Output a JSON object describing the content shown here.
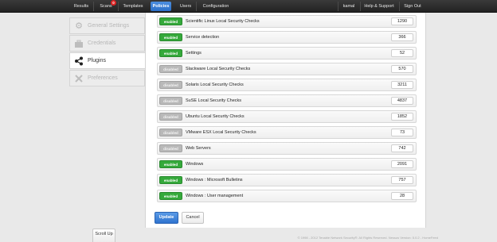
{
  "nav": {
    "results": "Results",
    "scans": "Scans",
    "scans_badge": "0",
    "templates": "Templates",
    "policies": "Policies",
    "users": "Users",
    "configuration": "Configuration",
    "user": "kamal",
    "help": "Help & Support",
    "signout": "Sign Out"
  },
  "sidebar": {
    "items": [
      {
        "label": "General Settings",
        "icon": "gear-icon"
      },
      {
        "label": "Credentials",
        "icon": "briefcase-icon"
      },
      {
        "label": "Plugins",
        "icon": "share-icon"
      },
      {
        "label": "Preferences",
        "icon": "wrench-screwdriver-icon"
      }
    ]
  },
  "plugin_rows": [
    {
      "status": "enabled",
      "name": "Scientific Linux Local Security Checks",
      "count": "1290"
    },
    {
      "status": "enabled",
      "name": "Service detection",
      "count": "366"
    },
    {
      "status": "enabled",
      "name": "Settings",
      "count": "52"
    },
    {
      "status": "disabled",
      "name": "Slackware Local Security Checks",
      "count": "570"
    },
    {
      "status": "disabled",
      "name": "Solaris Local Security Checks",
      "count": "3211"
    },
    {
      "status": "disabled",
      "name": "SuSE Local Security Checks",
      "count": "4837"
    },
    {
      "status": "disabled",
      "name": "Ubuntu Local Security Checks",
      "count": "1852"
    },
    {
      "status": "disabled",
      "name": "VMware ESX Local Security Checks",
      "count": "73"
    },
    {
      "status": "disabled",
      "name": "Web Servers",
      "count": "742"
    },
    {
      "status": "enabled",
      "name": "Windows",
      "count": "2091"
    },
    {
      "status": "enabled",
      "name": "Windows : Microsoft Bulletins",
      "count": "757"
    },
    {
      "status": "enabled",
      "name": "Windows : User management",
      "count": "28"
    }
  ],
  "buttons": {
    "update": "Update",
    "cancel": "Cancel"
  },
  "footer": "© 1998 - 2012 Tenable Network Security®. All Rights Reserved. Nessus Version: 5.0.2 - HomeFeed",
  "scroll_up": "Scroll Up",
  "colors": {
    "enabled": "#35a93b",
    "disabled": "#b9b9b9",
    "accent": "#2f73cf"
  }
}
